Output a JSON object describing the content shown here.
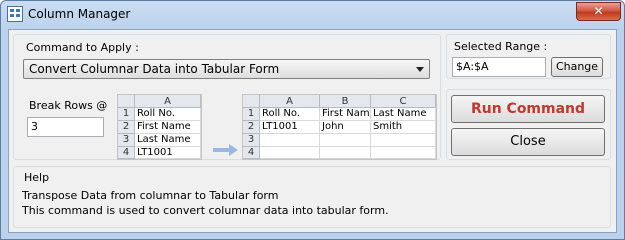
{
  "window": {
    "title": "Column Manager",
    "close_label": "✕"
  },
  "command": {
    "label": "Command to Apply :",
    "selected": "Convert Columnar Data into Tabular Form"
  },
  "range": {
    "label": "Selected Range :",
    "value": "$A:$A",
    "change_label": "Change"
  },
  "break_rows": {
    "label": "Break Rows @",
    "value": "3"
  },
  "preview_before": {
    "column": "A",
    "rows": [
      {
        "n": "1",
        "a": "Roll No."
      },
      {
        "n": "2",
        "a": "First Name"
      },
      {
        "n": "3",
        "a": "Last Name"
      },
      {
        "n": "4",
        "a": "LT1001"
      }
    ]
  },
  "preview_after": {
    "columns": [
      "A",
      "B",
      "C"
    ],
    "rows": [
      {
        "n": "1",
        "cells": [
          "Roll No.",
          "First Name",
          "Last Name"
        ]
      },
      {
        "n": "2",
        "cells": [
          "LT1001",
          "John",
          "Smith"
        ]
      },
      {
        "n": "3",
        "cells": [
          "",
          "",
          ""
        ]
      },
      {
        "n": "4",
        "cells": [
          "",
          "",
          ""
        ]
      }
    ]
  },
  "buttons": {
    "run": "Run Command",
    "close": "Close"
  },
  "help": {
    "label": "Help",
    "line1": "Transpose Data from columnar to Tabular form",
    "line2": "This command is used to convert columnar data into tabular form."
  },
  "colors": {
    "run_text": "#c0392b",
    "arrow": "#9db8de"
  },
  "icons": {
    "app": "grid-icon",
    "close": "close-icon",
    "dropdown": "chevron-down-icon",
    "arrow": "arrow-right-icon"
  }
}
